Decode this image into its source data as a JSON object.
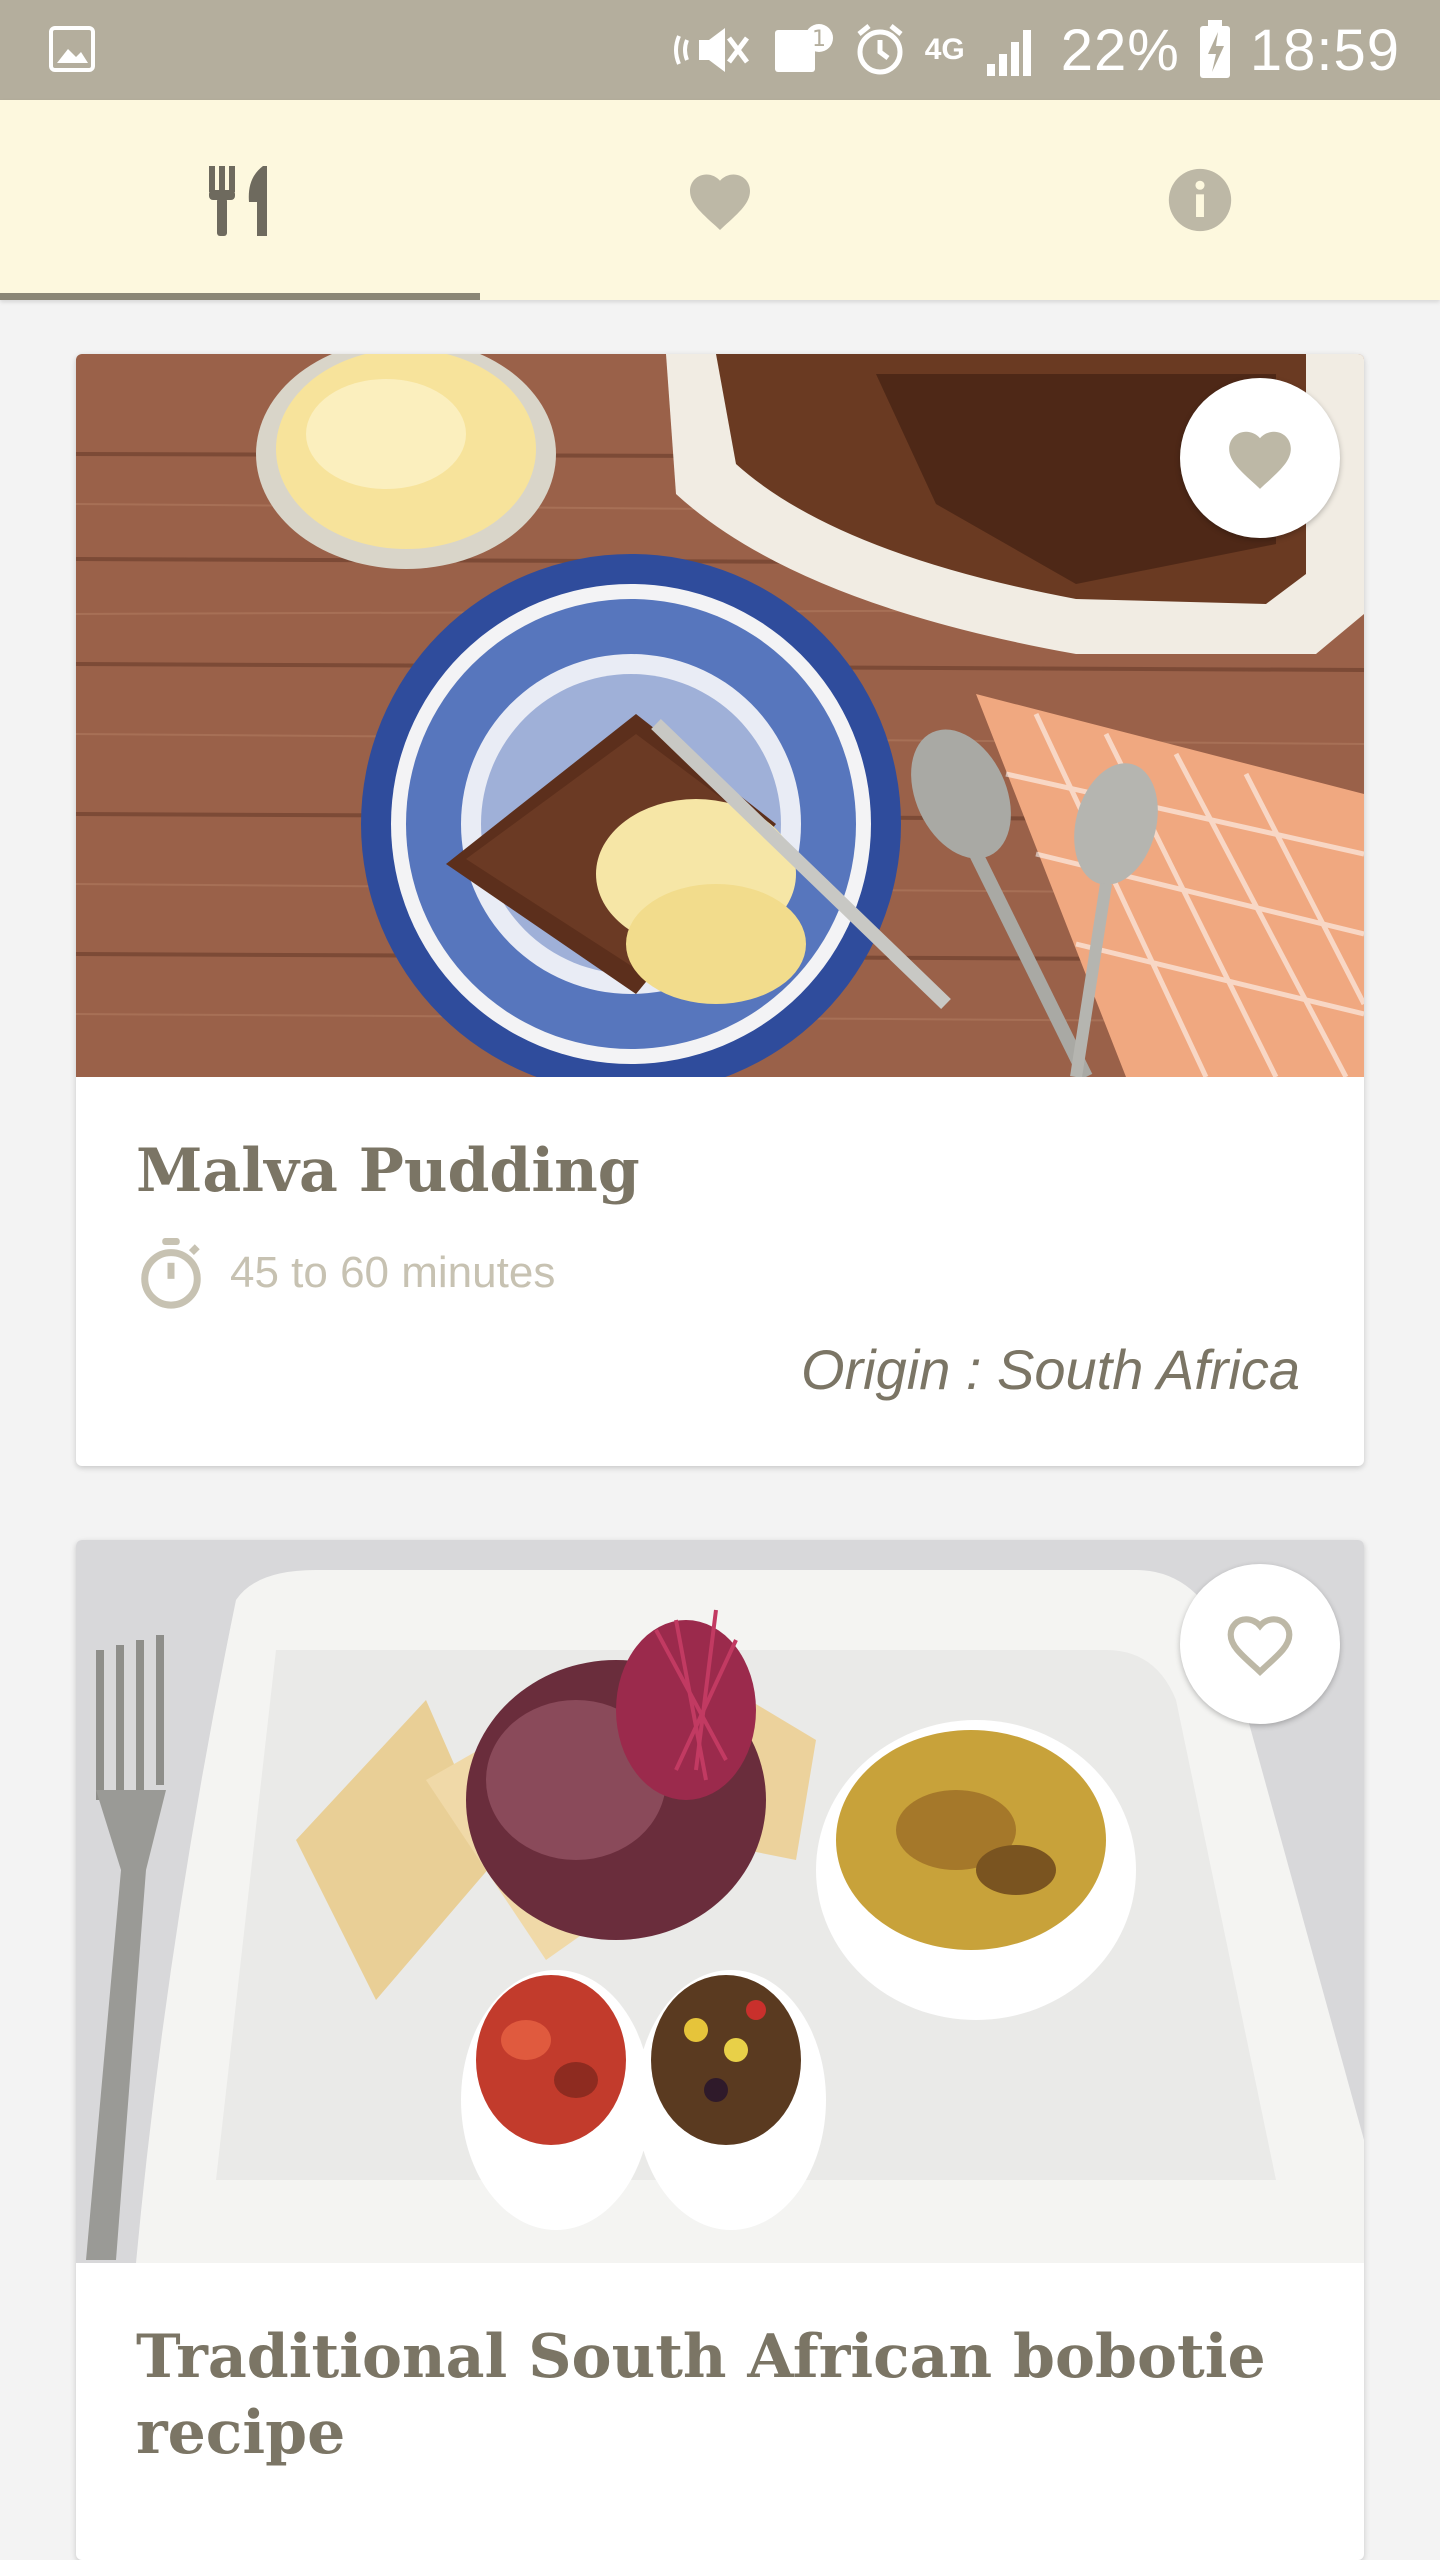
{
  "status_bar": {
    "network": "4G",
    "battery": "22%",
    "time": "18:59"
  },
  "tabs": [
    {
      "icon": "fork-knife-icon",
      "selected": true
    },
    {
      "icon": "heart-icon",
      "selected": false
    },
    {
      "icon": "info-icon",
      "selected": false
    }
  ],
  "recipes": [
    {
      "title": "Malva Pudding",
      "time": "45 to 60 minutes",
      "origin": "Origin : South Africa",
      "favorite": true
    },
    {
      "title": "Traditional South African bobotie recipe",
      "favorite": false
    }
  ],
  "colors": {
    "status_bar": "#b4ae9d",
    "tab_bar": "#fdf8de",
    "accent": "#8a8676",
    "text": "#7b7565",
    "muted": "#c7c2b2"
  }
}
